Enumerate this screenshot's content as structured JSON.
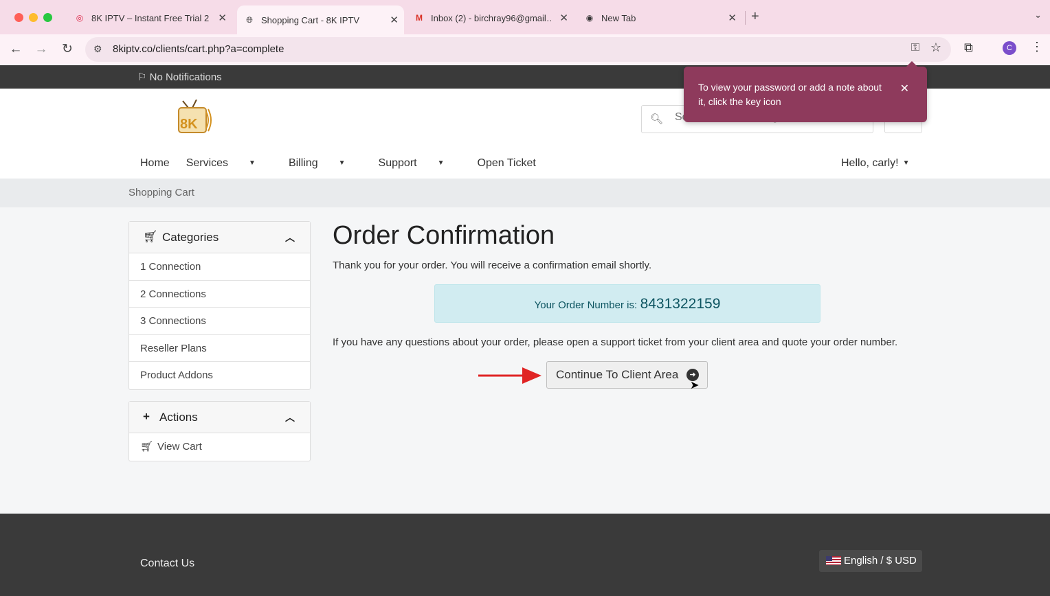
{
  "browser": {
    "tabs": [
      {
        "title": "8K IPTV – Instant Free Trial 2…",
        "icon": "pinterest-like-icon",
        "active": false
      },
      {
        "title": "Shopping Cart - 8K IPTV",
        "icon": "globe-icon",
        "active": true
      },
      {
        "title": "Inbox (2) - birchray96@gmail…",
        "icon": "gmail-icon",
        "active": false
      },
      {
        "title": "New Tab",
        "icon": "chrome-icon",
        "active": false
      }
    ],
    "url": "8kiptv.co/clients/cart.php?a=complete",
    "profile_initial": "C",
    "colors": {
      "tab_strip": "#f6dce8",
      "active_tab": "#fdf2f7",
      "profile": "#7b4ecb"
    }
  },
  "password_tooltip": {
    "message": "To view your password or add a note about it, click the key icon",
    "close_icon": "close-icon",
    "color": "#8e3a5c"
  },
  "topbar": {
    "notifications": "No Notifications"
  },
  "header": {
    "logo_text": "8K",
    "search_placeholder": "Search our knowledgebase...",
    "nav": [
      "Home",
      "Services",
      "Billing",
      "Support",
      "Open Ticket"
    ],
    "greeting": "Hello, carly!"
  },
  "breadcrumb": "Shopping Cart",
  "sidebar": {
    "categories_title": "Categories",
    "categories": [
      "1 Connection",
      "2 Connections",
      "3 Connections",
      "Reseller Plans",
      "Product Addons"
    ],
    "actions_title": "Actions",
    "actions": [
      "View Cart"
    ]
  },
  "main": {
    "heading": "Order Confirmation",
    "thanks": "Thank you for your order. You will receive a confirmation email shortly.",
    "order_label": "Your Order Number is:",
    "order_number": "8431322159",
    "questions": "If you have any questions about your order, please open a support ticket from your client area and quote your order number.",
    "continue_label": "Continue To Client Area",
    "arrow_color": "#e02424"
  },
  "footer": {
    "contact": "Contact Us",
    "language": "English / $ USD"
  }
}
